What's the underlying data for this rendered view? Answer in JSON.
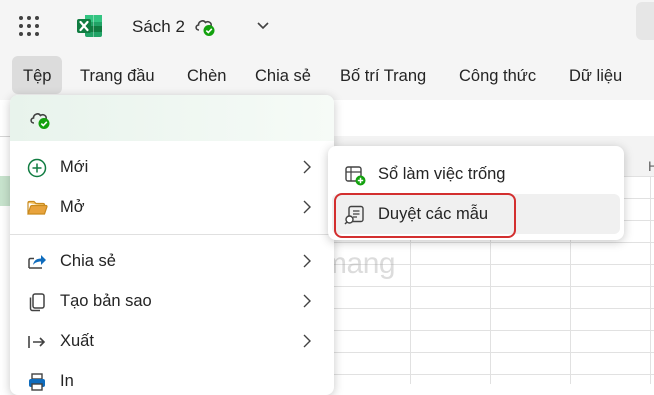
{
  "titlebar": {
    "doc_title": "Sách 2",
    "icons": [
      "app-launcher-icon",
      "excel-logo-icon",
      "cloud-saved-icon",
      "chevron-down-icon"
    ]
  },
  "ribbon": {
    "tabs": [
      {
        "label": "Tệp",
        "active": true
      },
      {
        "label": "Trang đầu"
      },
      {
        "label": "Chèn"
      },
      {
        "label": "Chia sẻ"
      },
      {
        "label": "Bố trí Trang"
      },
      {
        "label": "Công thức"
      },
      {
        "label": "Dữ liệu"
      }
    ]
  },
  "file_menu": {
    "items": [
      {
        "label": "Mới",
        "icon": "add-circle-icon",
        "has_submenu": true
      },
      {
        "label": "Mở",
        "icon": "folder-open-icon",
        "has_submenu": true
      },
      {
        "label": "Chia sẻ",
        "icon": "share-icon",
        "has_submenu": true
      },
      {
        "label": "Tạo bản sao",
        "icon": "copy-icon",
        "has_submenu": true
      },
      {
        "label": "Xuất",
        "icon": "export-icon",
        "has_submenu": true
      },
      {
        "label": "In",
        "icon": "print-icon",
        "has_submenu": false
      }
    ]
  },
  "submenu": {
    "items": [
      {
        "label": "Sổ làm việc trống",
        "icon": "blank-workbook-icon"
      },
      {
        "label": "Duyệt các mẫu",
        "icon": "browse-templates-icon",
        "highlighted": true
      }
    ]
  },
  "grid": {
    "partial_column_letter": "H"
  },
  "watermark": {
    "text": "uantrimang"
  },
  "colors": {
    "excel_green": "#107c41",
    "saved_green": "#13a10e",
    "highlight_red": "#d32f2f",
    "folder_orange": "#e8a33d",
    "share_blue": "#0f6cbd"
  }
}
